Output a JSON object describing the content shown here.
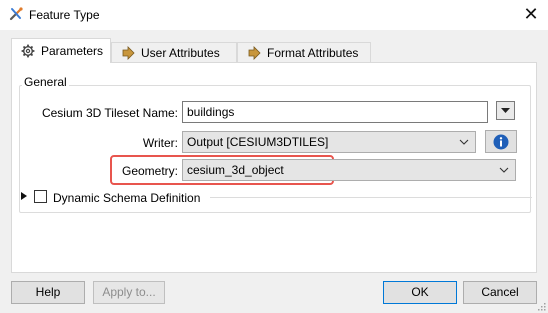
{
  "window": {
    "title": "Feature Type",
    "close_glyph": "✕",
    "app_icon": "fme-wrench-icon"
  },
  "tabs": [
    {
      "label": "Parameters",
      "icon": "gear-icon",
      "active": true
    },
    {
      "label": "User Attributes",
      "icon": "arrow-right-icon",
      "active": false
    },
    {
      "label": "Format Attributes",
      "icon": "arrow-right-icon",
      "active": false
    }
  ],
  "general": {
    "group_label": "General",
    "tileset_name_label": "Cesium 3D Tileset Name:",
    "tileset_name_value": "buildings",
    "writer_label": "Writer:",
    "writer_value": "Output [CESIUM3DTILES]",
    "geometry_label": "Geometry:",
    "geometry_value": "cesium_3d_object",
    "highlight_color": "#e8554e"
  },
  "dynamic_schema": {
    "label": "Dynamic Schema Definition",
    "checked": false
  },
  "buttons": {
    "help": "Help",
    "apply": "Apply to...",
    "ok": "OK",
    "cancel": "Cancel"
  }
}
